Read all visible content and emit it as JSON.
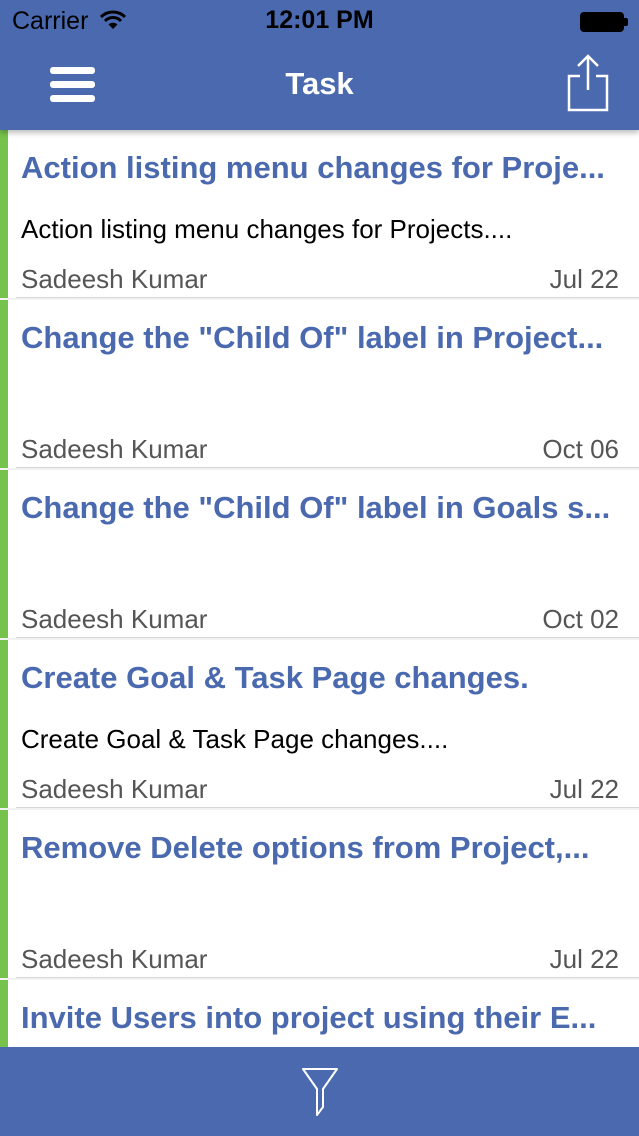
{
  "status_bar": {
    "carrier": "Carrier",
    "time": "12:01 PM"
  },
  "nav": {
    "title": "Task",
    "left_icon": "hamburger-menu-icon",
    "right_icon": "share-icon"
  },
  "colors": {
    "brand": "#4a69ae",
    "accent_bar": "#76c34b",
    "title_text": "#4a69ae"
  },
  "tasks": [
    {
      "title": "Action listing menu changes for Proje...",
      "description": "Action listing menu changes for Projects....",
      "owner": "Sadeesh Kumar",
      "date": "Jul 22"
    },
    {
      "title": "Change the \"Child Of\" label in Project...",
      "description": "",
      "owner": "Sadeesh Kumar",
      "date": "Oct 06"
    },
    {
      "title": "Change the \"Child Of\" label in Goals s...",
      "description": "",
      "owner": "Sadeesh Kumar",
      "date": "Oct 02"
    },
    {
      "title": "Create Goal & Task Page changes.",
      "description": "Create Goal & Task Page changes....",
      "owner": "Sadeesh Kumar",
      "date": "Jul 22"
    },
    {
      "title": "Remove Delete options from Project,...",
      "description": "",
      "owner": "Sadeesh Kumar",
      "date": "Jul 22"
    },
    {
      "title": "Invite Users into project using their E...",
      "description": "",
      "owner": "",
      "date": ""
    }
  ],
  "bottom_bar": {
    "icon": "filter-icon"
  }
}
